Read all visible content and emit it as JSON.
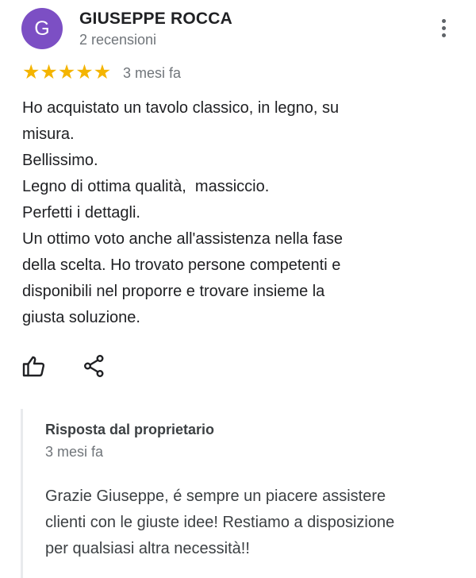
{
  "review": {
    "avatar_letter": "G",
    "avatar_color": "#7c4fc4",
    "author_name": "GIUSEPPE ROCCA",
    "review_count": "2 recensioni",
    "rating": 5,
    "rating_max": 5,
    "star_color": "#f4b400",
    "date": "3 mesi fa",
    "text_lines": [
      "Ho acquistato un tavolo classico, in legno, su",
      "misura.",
      "Bellissimo.",
      "Legno di ottima qualità,  massiccio.",
      "Perfetti i dettagli.",
      "Un ottimo voto anche all'assistenza nella fase",
      "della scelta. Ho trovato persone competenti e",
      "disponibili nel proporre e trovare insieme la",
      "giusta soluzione."
    ]
  },
  "actions": {
    "like_icon": "thumb-up-icon",
    "share_icon": "share-icon",
    "more_icon": "more-vert-icon"
  },
  "owner_reply": {
    "title": "Risposta dal proprietario",
    "date": "3 mesi fa",
    "text_lines": [
      "Grazie Giuseppe, é sempre un piacere assistere",
      "clienti con le giuste idee! Restiamo a disposizione",
      "per qualsiasi altra necessità!!"
    ]
  }
}
